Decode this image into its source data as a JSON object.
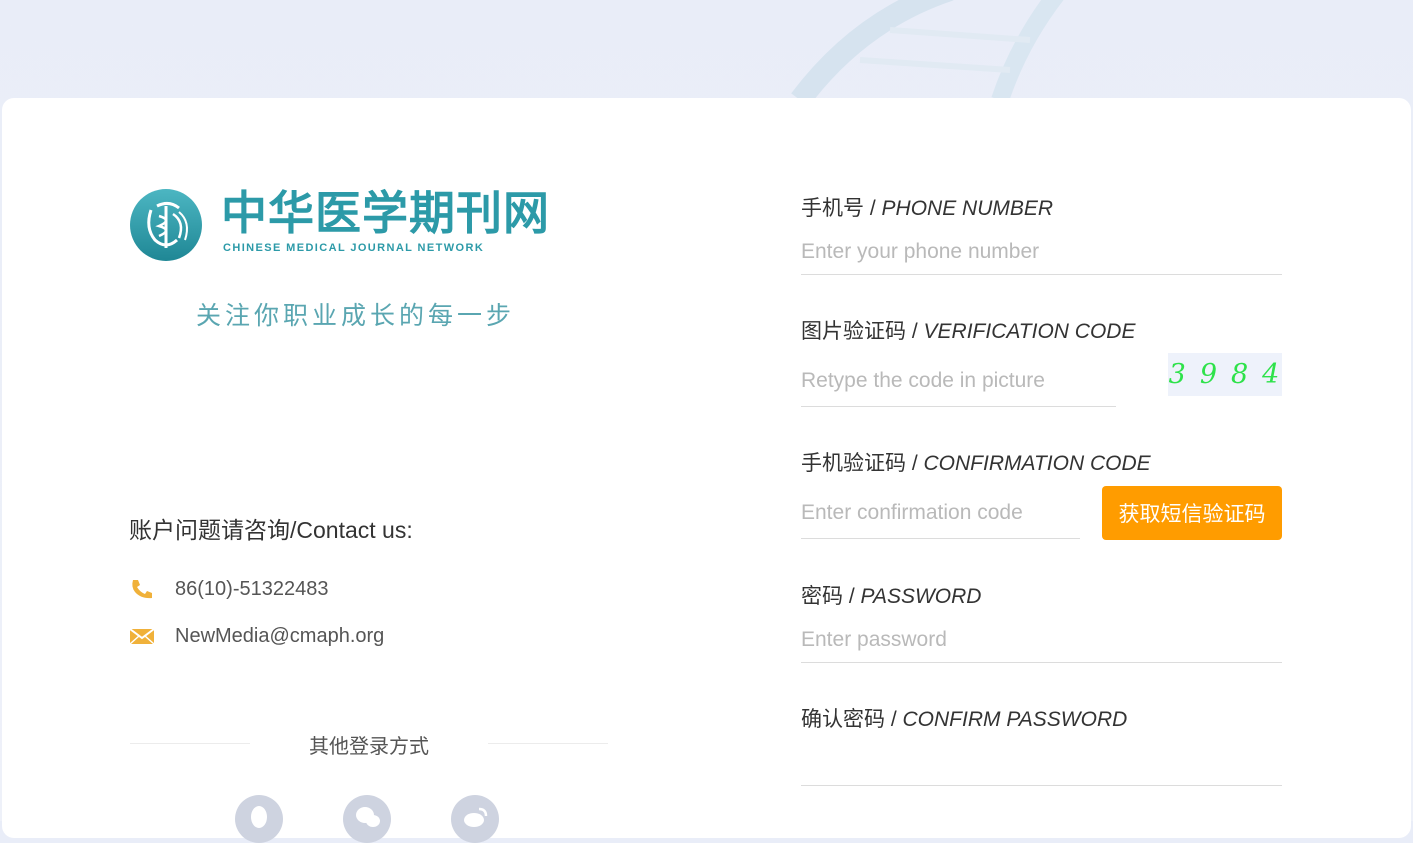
{
  "colors": {
    "brand": "#2c9aa8",
    "accent": "#ff9c00",
    "captcha_text": "#2ee24a",
    "contact_icon": "#f0b13a"
  },
  "brand": {
    "name_cn": "中华医学期刊网",
    "name_en": "CHINESE MEDICAL JOURNAL NETWORK",
    "slogan": "关注你职业成长的每一步"
  },
  "contact": {
    "title": "账户问题请咨询/Contact us:",
    "phone": "86(10)-51322483",
    "email": "NewMedia@cmaph.org",
    "phone_icon": "phone-icon",
    "email_icon": "envelope-icon"
  },
  "other_login": {
    "label": "其他登录方式",
    "methods": [
      {
        "name": "QQ",
        "icon": "qq-icon"
      },
      {
        "name": "WeChat",
        "icon": "wechat-icon"
      },
      {
        "name": "Weibo",
        "icon": "weibo-icon"
      }
    ]
  },
  "form": {
    "phone": {
      "label_cn": "手机号 / ",
      "label_en": "PHONE NUMBER",
      "placeholder": "Enter your phone number",
      "value": ""
    },
    "verification": {
      "label_cn": "图片验证码 / ",
      "label_en": "VERIFICATION CODE",
      "placeholder": "Retype the code in picture",
      "value": "",
      "captcha": "3984"
    },
    "confirmation": {
      "label_cn": "手机验证码 / ",
      "label_en": "CONFIRMATION CODE",
      "placeholder": "Enter confirmation code",
      "value": "",
      "button": "获取短信验证码"
    },
    "password": {
      "label_cn": "密码 / ",
      "label_en": "PASSWORD",
      "placeholder": "Enter password",
      "value": ""
    },
    "confirm_password": {
      "label_cn": "确认密码 / ",
      "label_en": "CONFIRM PASSWORD",
      "placeholder": "",
      "value": ""
    }
  }
}
